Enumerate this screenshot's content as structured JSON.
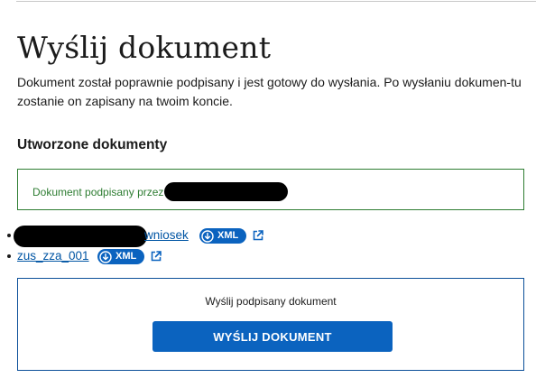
{
  "header": {
    "title": "Wyślij dokument",
    "intro": "Dokument został poprawnie podpisany i jest gotowy do wysłania. Po wysłaniu dokumen-tu zostanie on zapisany na twoim koncie."
  },
  "documents": {
    "heading": "Utworzone dokumenty",
    "alert_text": "Dokument podpisany przez",
    "items": [
      {
        "label": "wniosek",
        "badge": "XML",
        "icon": "download-icon",
        "open_icon": "external-link-icon"
      },
      {
        "label": "zus_zza_001",
        "badge": "XML",
        "icon": "download-icon",
        "open_icon": "external-link-icon"
      }
    ]
  },
  "send": {
    "label": "Wyślij podpisany dokument",
    "button": "WYŚLIJ DOKUMENT"
  },
  "colors": {
    "link": "#0055a4",
    "accent": "#0b63bf",
    "success": "#2e7d32",
    "text": "#1b1b1b"
  }
}
